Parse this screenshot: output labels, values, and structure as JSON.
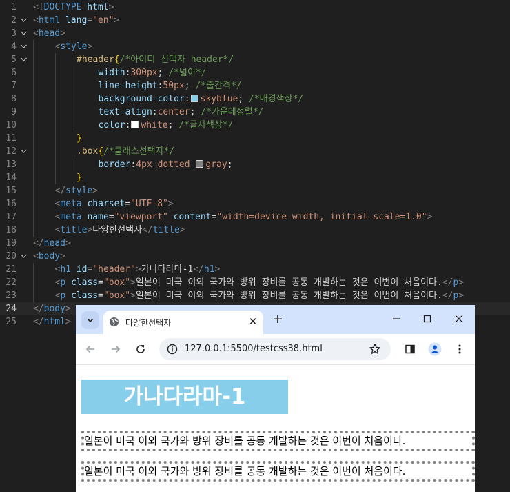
{
  "editor": {
    "lines": [
      {
        "n": "1",
        "fold": "",
        "active": false,
        "indent": 0,
        "tokens": [
          [
            "t-br",
            "<!"
          ],
          [
            "t-tag",
            "DOCTYPE"
          ],
          [
            "t-txt",
            " "
          ],
          [
            "t-attr",
            "html"
          ],
          [
            "t-br",
            ">"
          ]
        ]
      },
      {
        "n": "2",
        "fold": "v",
        "active": false,
        "indent": 0,
        "tokens": [
          [
            "t-br",
            "<"
          ],
          [
            "t-tag",
            "html"
          ],
          [
            "t-txt",
            " "
          ],
          [
            "t-attr",
            "lang"
          ],
          [
            "t-txt",
            "="
          ],
          [
            "t-str",
            "\"en\""
          ],
          [
            "t-br",
            ">"
          ]
        ]
      },
      {
        "n": "3",
        "fold": "v",
        "active": false,
        "indent": 0,
        "tokens": [
          [
            "t-br",
            "<"
          ],
          [
            "t-tag",
            "head"
          ],
          [
            "t-br",
            ">"
          ]
        ]
      },
      {
        "n": "4",
        "fold": "v",
        "active": false,
        "indent": 1,
        "tokens": [
          [
            "t-br",
            "<"
          ],
          [
            "t-tag",
            "style"
          ],
          [
            "t-br",
            ">"
          ]
        ]
      },
      {
        "n": "5",
        "fold": "v",
        "active": false,
        "indent": 2,
        "tokens": [
          [
            "t-sel",
            "#header"
          ],
          [
            "t-br2",
            "{"
          ],
          [
            "t-cmt",
            "/*아이디 선택자 header*/"
          ]
        ]
      },
      {
        "n": "6",
        "fold": "",
        "active": false,
        "indent": 3,
        "tokens": [
          [
            "t-attr",
            "width"
          ],
          [
            "t-txt",
            ":"
          ],
          [
            "t-str",
            "300px"
          ],
          [
            "t-txt",
            "; "
          ],
          [
            "t-cmt",
            "/*넓이*/"
          ]
        ]
      },
      {
        "n": "7",
        "fold": "",
        "active": false,
        "indent": 3,
        "tokens": [
          [
            "t-attr",
            "line-height"
          ],
          [
            "t-txt",
            ":"
          ],
          [
            "t-str",
            "50px"
          ],
          [
            "t-txt",
            "; "
          ],
          [
            "t-cmt",
            "/*줄간격*/"
          ]
        ]
      },
      {
        "n": "8",
        "fold": "",
        "active": false,
        "indent": 3,
        "tokens": [
          [
            "t-attr",
            "background-color"
          ],
          [
            "t-txt",
            ":"
          ],
          [
            "sw",
            "#87ceeb"
          ],
          [
            "t-str",
            "skyblue"
          ],
          [
            "t-txt",
            "; "
          ],
          [
            "t-cmt",
            "/*배경색상*/"
          ]
        ]
      },
      {
        "n": "9",
        "fold": "",
        "active": false,
        "indent": 3,
        "tokens": [
          [
            "t-attr",
            "text-align"
          ],
          [
            "t-txt",
            ":"
          ],
          [
            "t-str",
            "center"
          ],
          [
            "t-txt",
            "; "
          ],
          [
            "t-cmt",
            "/*가운데정렬*/"
          ]
        ]
      },
      {
        "n": "10",
        "fold": "",
        "active": false,
        "indent": 3,
        "tokens": [
          [
            "t-attr",
            "color"
          ],
          [
            "t-txt",
            ":"
          ],
          [
            "sw",
            "#ffffff"
          ],
          [
            "t-str",
            "white"
          ],
          [
            "t-txt",
            "; "
          ],
          [
            "t-cmt",
            "/*글자색상*/"
          ]
        ]
      },
      {
        "n": "11",
        "fold": "",
        "active": false,
        "indent": 2,
        "tokens": [
          [
            "t-br2",
            "}"
          ]
        ]
      },
      {
        "n": "12",
        "fold": "v",
        "active": false,
        "indent": 2,
        "tokens": [
          [
            "t-sel",
            ".box"
          ],
          [
            "t-br2",
            "{"
          ],
          [
            "t-cmt",
            "/*클래스선택자*/"
          ]
        ]
      },
      {
        "n": "13",
        "fold": "",
        "active": false,
        "indent": 3,
        "tokens": [
          [
            "t-attr",
            "border"
          ],
          [
            "t-txt",
            ":"
          ],
          [
            "t-str",
            "4px dotted "
          ],
          [
            "sw",
            "#808080"
          ],
          [
            "t-str",
            "gray"
          ],
          [
            "t-txt",
            ";"
          ]
        ]
      },
      {
        "n": "14",
        "fold": "",
        "active": false,
        "indent": 2,
        "tokens": [
          [
            "t-br2",
            "}"
          ]
        ]
      },
      {
        "n": "15",
        "fold": "",
        "active": false,
        "indent": 1,
        "tokens": [
          [
            "t-br",
            "</"
          ],
          [
            "t-tag",
            "style"
          ],
          [
            "t-br",
            ">"
          ]
        ]
      },
      {
        "n": "16",
        "fold": "",
        "active": false,
        "indent": 1,
        "tokens": [
          [
            "t-br",
            "<"
          ],
          [
            "t-tag",
            "meta"
          ],
          [
            "t-txt",
            " "
          ],
          [
            "t-attr",
            "charset"
          ],
          [
            "t-txt",
            "="
          ],
          [
            "t-str",
            "\"UTF-8\""
          ],
          [
            "t-br",
            ">"
          ]
        ]
      },
      {
        "n": "17",
        "fold": "",
        "active": false,
        "indent": 1,
        "tokens": [
          [
            "t-br",
            "<"
          ],
          [
            "t-tag",
            "meta"
          ],
          [
            "t-txt",
            " "
          ],
          [
            "t-attr",
            "name"
          ],
          [
            "t-txt",
            "="
          ],
          [
            "t-str",
            "\"viewport\""
          ],
          [
            "t-txt",
            " "
          ],
          [
            "t-attr",
            "content"
          ],
          [
            "t-txt",
            "="
          ],
          [
            "t-str",
            "\"width=device-width, initial-scale=1.0\""
          ],
          [
            "t-br",
            ">"
          ]
        ]
      },
      {
        "n": "18",
        "fold": "",
        "active": false,
        "indent": 1,
        "tokens": [
          [
            "t-br",
            "<"
          ],
          [
            "t-tag",
            "title"
          ],
          [
            "t-br",
            ">"
          ],
          [
            "t-txt",
            "다양한선택자"
          ],
          [
            "t-br",
            "</"
          ],
          [
            "t-tag",
            "title"
          ],
          [
            "t-br",
            ">"
          ]
        ]
      },
      {
        "n": "19",
        "fold": "",
        "active": false,
        "indent": 0,
        "tokens": [
          [
            "t-br",
            "</"
          ],
          [
            "t-tag",
            "head"
          ],
          [
            "t-br",
            ">"
          ]
        ]
      },
      {
        "n": "20",
        "fold": "v",
        "active": false,
        "indent": 0,
        "tokens": [
          [
            "t-br",
            "<"
          ],
          [
            "t-tag",
            "body"
          ],
          [
            "t-br",
            ">"
          ]
        ]
      },
      {
        "n": "21",
        "fold": "",
        "active": false,
        "indent": 1,
        "tokens": [
          [
            "t-br",
            "<"
          ],
          [
            "t-tag",
            "h1"
          ],
          [
            "t-txt",
            " "
          ],
          [
            "t-attr",
            "id"
          ],
          [
            "t-txt",
            "="
          ],
          [
            "t-str",
            "\"header\""
          ],
          [
            "t-br",
            ">"
          ],
          [
            "t-txt",
            "가나다라마-1"
          ],
          [
            "t-br",
            "</"
          ],
          [
            "t-tag",
            "h1"
          ],
          [
            "t-br",
            ">"
          ]
        ]
      },
      {
        "n": "22",
        "fold": "",
        "active": false,
        "indent": 1,
        "tokens": [
          [
            "t-br",
            "<"
          ],
          [
            "t-tag",
            "p"
          ],
          [
            "t-txt",
            " "
          ],
          [
            "t-attr",
            "class"
          ],
          [
            "t-txt",
            "="
          ],
          [
            "t-str",
            "\"box\""
          ],
          [
            "t-br",
            ">"
          ],
          [
            "t-txt",
            "일본이 미국 이외 국가와 방위 장비를 공동 개발하는 것은 이번이 처음이다."
          ],
          [
            "t-br",
            "</"
          ],
          [
            "t-tag",
            "p"
          ],
          [
            "t-br",
            ">"
          ]
        ]
      },
      {
        "n": "23",
        "fold": "",
        "active": false,
        "indent": 1,
        "tokens": [
          [
            "t-br",
            "<"
          ],
          [
            "t-tag",
            "p"
          ],
          [
            "t-txt",
            " "
          ],
          [
            "t-attr",
            "class"
          ],
          [
            "t-txt",
            "="
          ],
          [
            "t-str",
            "\"box\""
          ],
          [
            "t-br",
            ">"
          ],
          [
            "t-txt",
            "일본이 미국 이외 국가와 방위 장비를 공동 개발하는 것은 이번이 처음이다."
          ],
          [
            "t-br",
            "</"
          ],
          [
            "t-tag",
            "p"
          ],
          [
            "t-br",
            ">"
          ]
        ]
      },
      {
        "n": "24",
        "fold": "",
        "active": true,
        "indent": 0,
        "tokens": [
          [
            "t-br",
            "</"
          ],
          [
            "t-tag",
            "body"
          ],
          [
            "t-br",
            ">"
          ]
        ]
      },
      {
        "n": "25",
        "fold": "",
        "active": false,
        "indent": 0,
        "tokens": [
          [
            "t-br",
            "</"
          ],
          [
            "t-tag",
            "html"
          ],
          [
            "t-br",
            ">"
          ]
        ]
      }
    ]
  },
  "browser": {
    "tab_title": "다양한선택자",
    "url": "127.0.0.1:5500/testcss38.html",
    "page": {
      "heading": "가나다라마-1",
      "paragraphs": [
        "일본이 미국 이외 국가와 방위 장비를 공동 개발하는 것은 이번이 처음이다.",
        "일본이 미국 이외 국가와 방위 장비를 공동 개발하는 것은 이번이 처음이다."
      ]
    }
  }
}
